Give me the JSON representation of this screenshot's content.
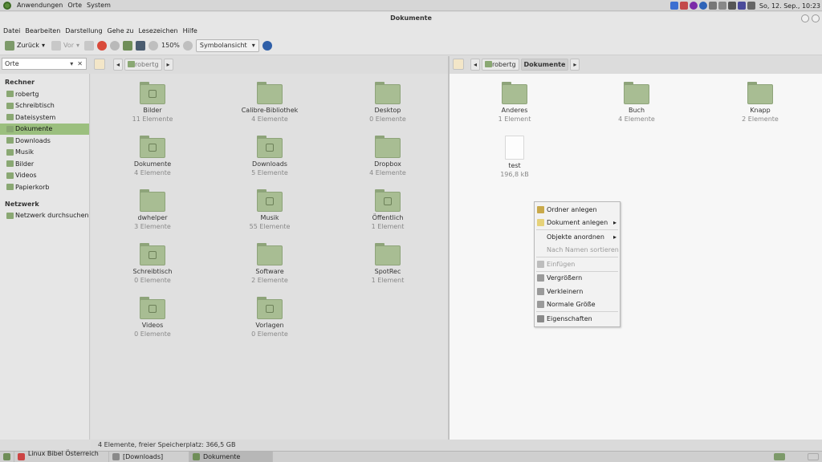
{
  "top_panel": {
    "menus": [
      "Anwendungen",
      "Orte",
      "System"
    ],
    "clock": "So, 12. Sep., 10:23"
  },
  "window": {
    "title": "Dokumente"
  },
  "menubar": [
    "Datei",
    "Bearbeiten",
    "Darstellung",
    "Gehe zu",
    "Lesezeichen",
    "Hilfe"
  ],
  "toolbar": {
    "back_label": "Zurück",
    "forward_label": "Vor",
    "zoom_level": "150%",
    "view_mode": "Symbolansicht"
  },
  "sidebar": {
    "combo_label": "Orte",
    "section_computer": "Rechner",
    "items": [
      "robertg",
      "Schreibtisch",
      "Dateisystem",
      "Dokumente",
      "Downloads",
      "Musik",
      "Bilder",
      "Videos",
      "Papierkorb"
    ],
    "selected_item": "Dokumente",
    "section_network": "Netzwerk",
    "network_items": [
      "Netzwerk durchsuchen"
    ]
  },
  "left_pane": {
    "path": [
      "robertg"
    ],
    "items": [
      {
        "name": "Bilder",
        "sub": "11 Elemente",
        "emblem": "camera"
      },
      {
        "name": "Calibre-Bibliothek",
        "sub": "4 Elemente",
        "emblem": ""
      },
      {
        "name": "Desktop",
        "sub": "0 Elemente",
        "emblem": ""
      },
      {
        "name": "Dokumente",
        "sub": "4 Elemente",
        "emblem": "document"
      },
      {
        "name": "Downloads",
        "sub": "5 Elemente",
        "emblem": "download"
      },
      {
        "name": "Dropbox",
        "sub": "4 Elemente",
        "emblem": ""
      },
      {
        "name": "dwhelper",
        "sub": "3 Elemente",
        "emblem": ""
      },
      {
        "name": "Musik",
        "sub": "55 Elemente",
        "emblem": "music"
      },
      {
        "name": "Öffentlich",
        "sub": "1 Element",
        "emblem": "share"
      },
      {
        "name": "Schreibtisch",
        "sub": "0 Elemente",
        "emblem": "desktop"
      },
      {
        "name": "Software",
        "sub": "2 Elemente",
        "emblem": ""
      },
      {
        "name": "SpotRec",
        "sub": "1 Element",
        "emblem": ""
      },
      {
        "name": "Videos",
        "sub": "0 Elemente",
        "emblem": "film"
      },
      {
        "name": "Vorlagen",
        "sub": "0 Elemente",
        "emblem": "template"
      }
    ]
  },
  "right_pane": {
    "path": [
      "robertg",
      "Dokumente"
    ],
    "items": [
      {
        "name": "Anderes",
        "sub": "1 Element",
        "kind": "folder"
      },
      {
        "name": "Buch",
        "sub": "4 Elemente",
        "kind": "folder"
      },
      {
        "name": "Knapp",
        "sub": "2 Elemente",
        "kind": "folder"
      },
      {
        "name": "test",
        "sub": "196,8 kB",
        "kind": "file"
      }
    ]
  },
  "context_menu": {
    "items": [
      {
        "label": "Ordner anlegen",
        "disabled": false,
        "submenu": false,
        "icon": "folder-new-icon"
      },
      {
        "label": "Dokument anlegen",
        "disabled": false,
        "submenu": true,
        "icon": "document-new-icon"
      },
      {
        "label": "Objekte anordnen",
        "disabled": false,
        "submenu": true,
        "icon": ""
      },
      {
        "label": "Nach Namen sortieren",
        "disabled": true,
        "submenu": false,
        "icon": ""
      },
      {
        "label": "Einfügen",
        "disabled": true,
        "submenu": false,
        "icon": "paste-icon"
      },
      {
        "label": "Vergrößern",
        "disabled": false,
        "submenu": false,
        "icon": "zoom-in-icon"
      },
      {
        "label": "Verkleinern",
        "disabled": false,
        "submenu": false,
        "icon": "zoom-out-icon"
      },
      {
        "label": "Normale Größe",
        "disabled": false,
        "submenu": false,
        "icon": "zoom-normal-icon"
      },
      {
        "label": "Eigenschaften",
        "disabled": false,
        "submenu": false,
        "icon": "properties-icon"
      }
    ]
  },
  "statusbar": {
    "text": "4 Elemente, freier Speicherplatz: 366,5 GB"
  },
  "taskbar": {
    "tasks": [
      {
        "label": "Linux Bibel Österreich ...",
        "active": false
      },
      {
        "label": "[Downloads]",
        "active": false
      },
      {
        "label": "Dokumente",
        "active": true
      }
    ]
  },
  "colors": {
    "accent": "#9bbf7e",
    "folder": "#a8bd93",
    "folder_dark": "#8ea47a"
  }
}
